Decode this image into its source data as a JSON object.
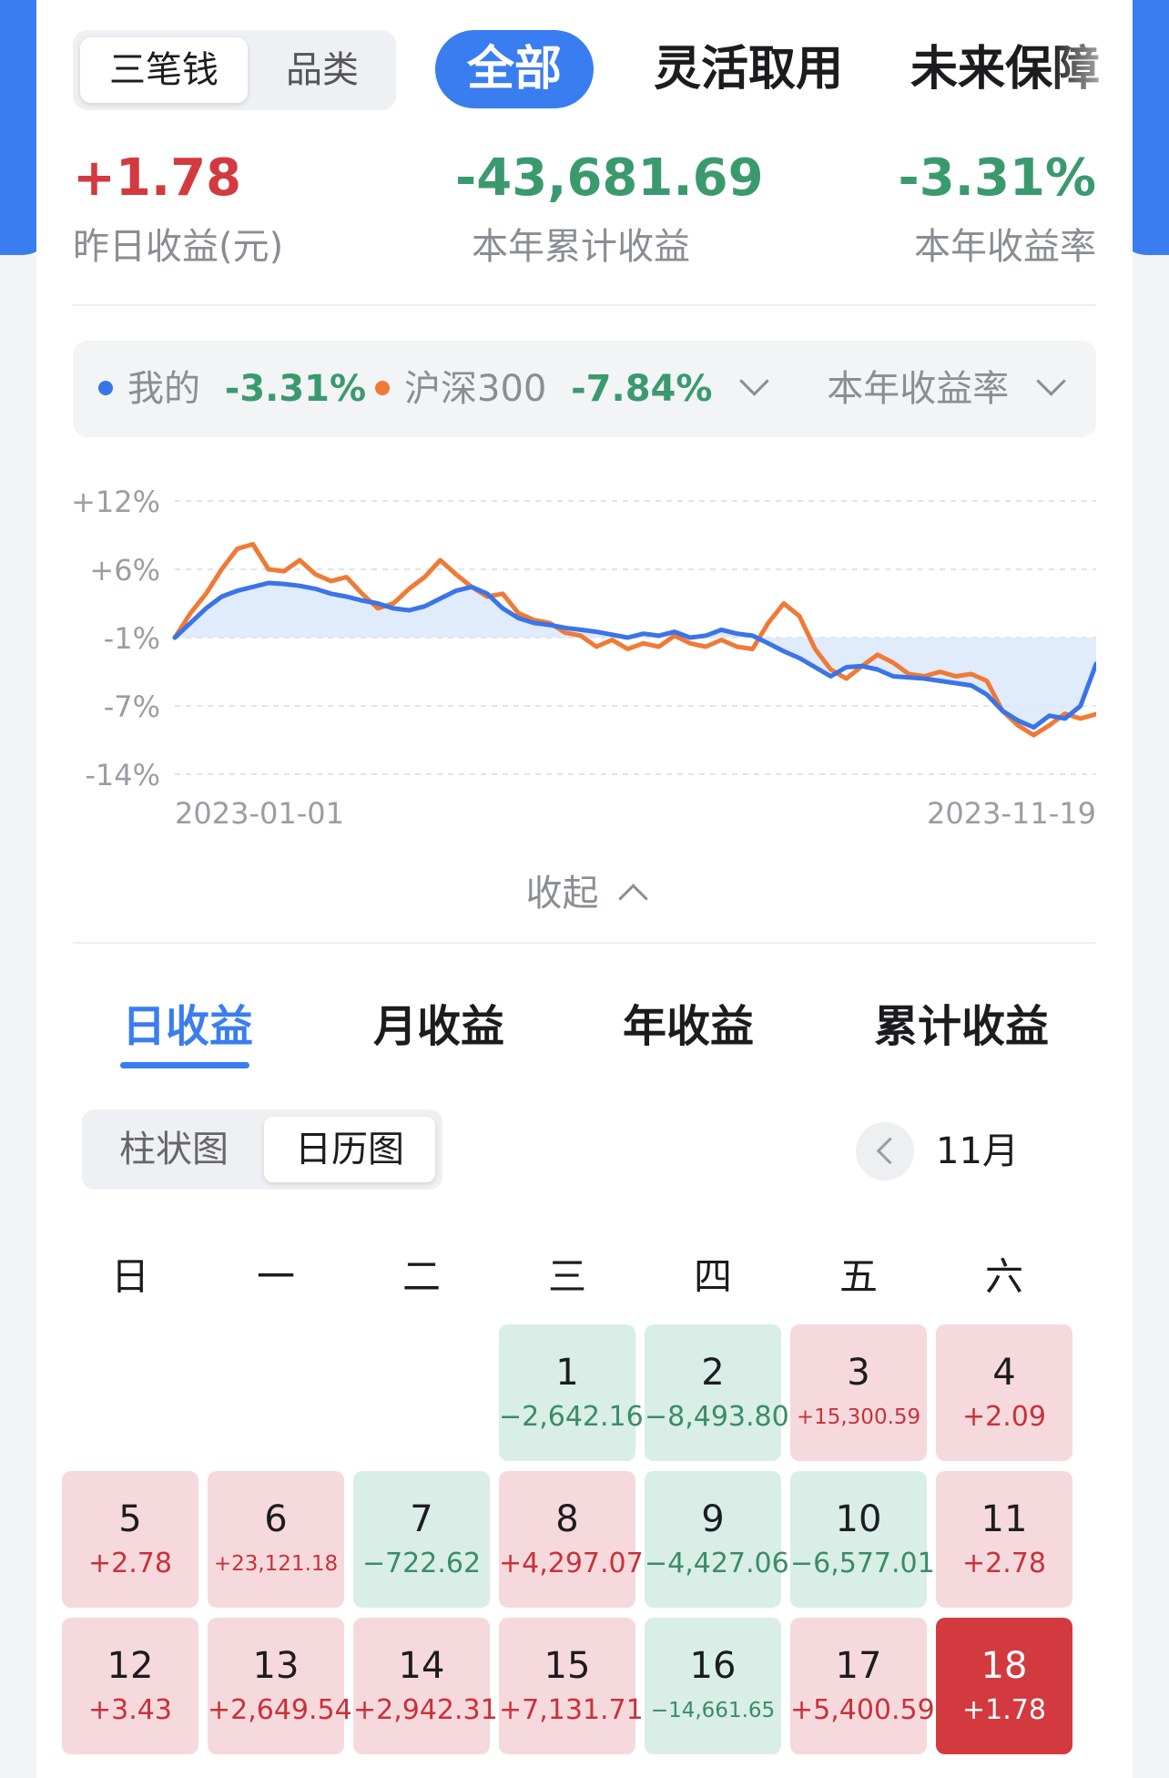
{
  "top_tabs": {
    "segment": [
      "三笔钱",
      "品类"
    ],
    "active_tab": "全部",
    "tabs": [
      "灵活取用",
      "未来保障"
    ]
  },
  "stats": {
    "yesterday": {
      "value": "+1.78",
      "label": "昨日收益(元)"
    },
    "ytd_income": {
      "value": "-43,681.69",
      "label": "本年累计收益"
    },
    "ytd_rate": {
      "value": "-3.31%",
      "label": "本年收益率"
    }
  },
  "legend": {
    "mine_label": "我的",
    "mine_value": "-3.31%",
    "index_label": "沪深300",
    "index_value": "-7.84%",
    "metric": "本年收益率"
  },
  "colors": {
    "mine": "#3a74e8",
    "index": "#f07a35",
    "red": "#d23a3f",
    "green": "#3a9a6e",
    "blue": "#3a7df0"
  },
  "chart_data": {
    "type": "line",
    "y_ticks": [
      "+12%",
      "+6%",
      "-1%",
      "-7%",
      "-14%"
    ],
    "x_ticks": [
      "2023-01-01",
      "2023-11-19"
    ],
    "ylim": [
      -14,
      12
    ],
    "grid": true,
    "series": [
      {
        "name": "我的",
        "values": [
          -1.0,
          0.5,
          2.0,
          3.2,
          3.8,
          4.2,
          4.6,
          4.5,
          4.3,
          4.0,
          3.5,
          3.2,
          2.8,
          2.5,
          2.0,
          1.8,
          2.2,
          3.0,
          3.8,
          4.2,
          3.5,
          2.0,
          1.0,
          0.5,
          0.3,
          0.0,
          -0.2,
          -0.4,
          -0.7,
          -1.0,
          -0.6,
          -0.8,
          -0.4,
          -1.0,
          -0.8,
          -0.2,
          -0.6,
          -0.8,
          -1.5,
          -2.2,
          -2.8,
          -3.6,
          -4.4,
          -3.6,
          -3.5,
          -3.8,
          -4.4,
          -4.5,
          -4.6,
          -4.8,
          -5.0,
          -5.2,
          -6.0,
          -7.5,
          -8.5,
          -9.2,
          -8.0,
          -8.3,
          -7.0,
          -3.3
        ]
      },
      {
        "name": "沪深300",
        "values": [
          -1.0,
          1.5,
          3.5,
          6.0,
          7.8,
          8.2,
          6.0,
          5.8,
          6.8,
          5.5,
          4.8,
          5.2,
          3.5,
          2.0,
          2.5,
          4.0,
          5.2,
          6.8,
          5.5,
          4.2,
          3.2,
          3.5,
          1.5,
          0.8,
          0.5,
          -0.5,
          -0.8,
          -1.8,
          -1.2,
          -2.0,
          -1.5,
          -1.8,
          -0.8,
          -1.5,
          -1.8,
          -1.2,
          -1.8,
          -2.0,
          0.5,
          2.5,
          1.2,
          -2.0,
          -3.8,
          -4.6,
          -3.5,
          -2.5,
          -3.2,
          -4.2,
          -4.4,
          -4.0,
          -4.4,
          -4.2,
          -4.8,
          -7.5,
          -9.0,
          -10.0,
          -9.0,
          -7.8,
          -8.3,
          -7.84
        ]
      }
    ]
  },
  "collapse_label": "收起",
  "income_tabs": [
    "日收益",
    "月收益",
    "年收益",
    "累计收益"
  ],
  "view_toggle": [
    "柱状图",
    "日历图"
  ],
  "month_label": "11月",
  "weekdays": [
    "日",
    "一",
    "二",
    "三",
    "四",
    "五",
    "六"
  ],
  "calendar": [
    {
      "day": "1",
      "value": "−2,642.16"
    },
    {
      "day": "2",
      "value": "−8,493.80"
    },
    {
      "day": "3",
      "value": "+15,300.59"
    },
    {
      "day": "4",
      "value": "+2.09"
    },
    {
      "day": "5",
      "value": "+2.78"
    },
    {
      "day": "6",
      "value": "+23,121.18"
    },
    {
      "day": "7",
      "value": "−722.62"
    },
    {
      "day": "8",
      "value": "+4,297.07"
    },
    {
      "day": "9",
      "value": "−4,427.06"
    },
    {
      "day": "10",
      "value": "−6,577.01"
    },
    {
      "day": "11",
      "value": "+2.78"
    },
    {
      "day": "12",
      "value": "+3.43"
    },
    {
      "day": "13",
      "value": "+2,649.54"
    },
    {
      "day": "14",
      "value": "+2,942.31"
    },
    {
      "day": "15",
      "value": "+7,131.71"
    },
    {
      "day": "16",
      "value": "−14,661.65"
    },
    {
      "day": "17",
      "value": "+5,400.59"
    },
    {
      "day": "18",
      "value": "+1.78"
    }
  ]
}
